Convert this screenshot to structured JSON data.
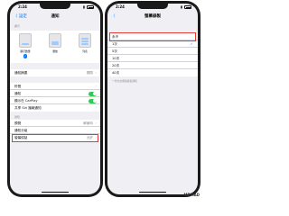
{
  "left": {
    "status": {
      "time": "2:24"
    },
    "nav": {
      "back": "〈 設定",
      "title": "通知"
    },
    "section_display": "顯示",
    "previews": [
      {
        "label": "顯示數量",
        "checked": true
      },
      {
        "label": "疊放",
        "checked": false
      },
      {
        "label": "列表",
        "checked": false
      }
    ],
    "rows1": [
      {
        "label": "通知摘要",
        "value": "關閉"
      }
    ],
    "rows2": [
      {
        "label": "鈴聲"
      },
      {
        "label": "通知"
      },
      {
        "label": "顯示在 CarPlay"
      },
      {
        "label": "共享 Siri 播報通知"
      }
    ],
    "section_sharing": "通知",
    "rows3": [
      {
        "label": "預覽",
        "value": "解鎖時"
      },
      {
        "label": "通知分組"
      },
      {
        "label": "螢幕錄製",
        "value": "允許"
      }
    ]
  },
  "right": {
    "status": {
      "time": "2:24"
    },
    "nav": {
      "back": "〈",
      "title": "螢幕錄製"
    },
    "options": [
      {
        "label": "永不",
        "checked": false
      },
      {
        "label": "1次",
        "checked": true
      },
      {
        "label": "5次",
        "checked": false
      },
      {
        "label": "10次",
        "checked": false
      },
      {
        "label": "20次",
        "checked": false
      },
      {
        "label": "40次",
        "checked": false
      }
    ],
    "note": "一律允許螢幕錄製通知"
  },
  "watermark": "MRMAD",
  "colors": {
    "accent": "#007aff",
    "toggle_on": "#34c759",
    "highlight": "#e53935"
  }
}
